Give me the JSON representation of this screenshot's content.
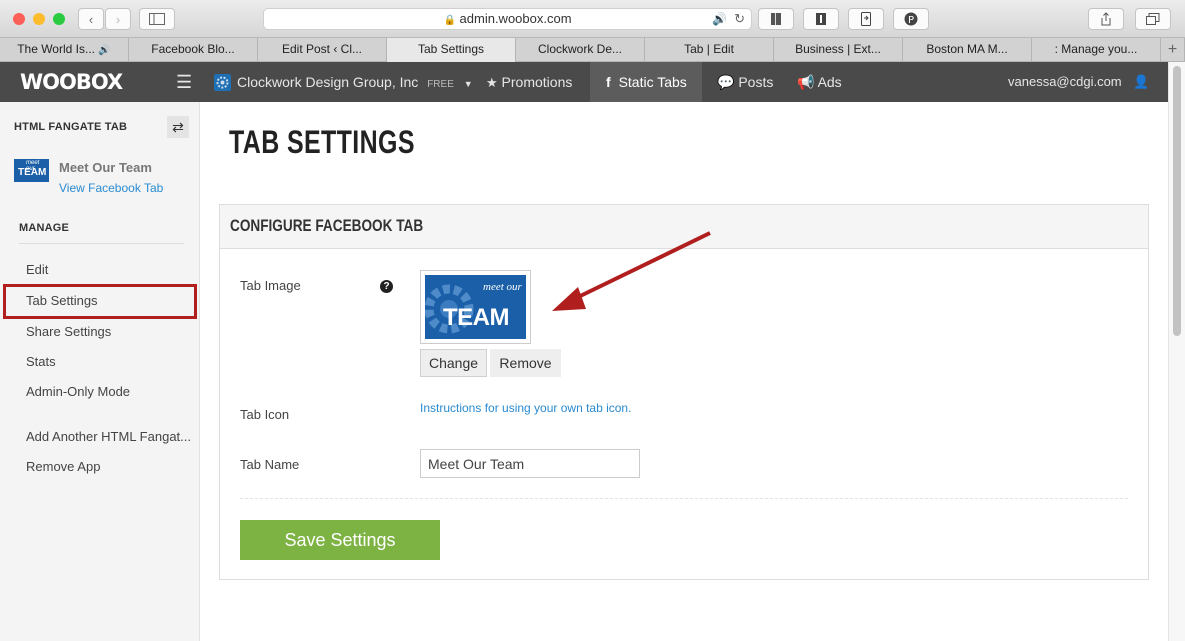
{
  "browser": {
    "url": "admin.woobox.com",
    "tabs": [
      {
        "label": "The World Is...",
        "audio": "🔊"
      },
      {
        "label": "Facebook Blo..."
      },
      {
        "label": "Edit Post ‹ Cl..."
      },
      {
        "label": "Tab Settings"
      },
      {
        "label": "Clockwork De..."
      },
      {
        "label": "Tab | Edit"
      },
      {
        "label": "Business | Ext..."
      },
      {
        "label": "Boston MA M..."
      },
      {
        "label": ": Manage you..."
      }
    ],
    "new_tab": "+"
  },
  "nav": {
    "logo": "WOOBOX",
    "menu_icon": "☰",
    "page_name": "Clockwork Design Group, Inc",
    "plan": "FREE",
    "items": {
      "promotions": "Promotions",
      "static_tabs": "Static Tabs",
      "posts": "Posts",
      "ads": "Ads"
    },
    "user": "vanessa@cdgi.com"
  },
  "sidebar": {
    "app_type": "HTML FANGATE TAB",
    "tab_name": "Meet Our Team",
    "view_link": "View Facebook Tab",
    "manage_heading": "MANAGE",
    "items": [
      "Edit",
      "Tab Settings",
      "Share Settings",
      "Stats",
      "Admin-Only Mode"
    ],
    "add_another": "Add Another HTML Fangat...",
    "remove_app": "Remove App",
    "thumb_small_text": "meet our",
    "thumb_big_text": "TEAM"
  },
  "main": {
    "title": "TAB SETTINGS",
    "panel_title": "CONFIGURE FACEBOOK TAB",
    "tab_image_label": "Tab Image",
    "help": "?",
    "image_small_text": "meet our",
    "image_big_text": "TEAM",
    "change_button": "Change",
    "remove_button": "Remove",
    "tab_icon_label": "Tab Icon",
    "tab_icon_link": "Instructions for using your own tab icon.",
    "tab_name_label": "Tab Name",
    "tab_name_value": "Meet Our Team",
    "save_button": "Save Settings"
  },
  "colors": {
    "nav_bg": "#4a4a4a",
    "link": "#2a8bd0",
    "save_green": "#7cb342",
    "highlight_red": "#b01e1e",
    "team_blue": "#1a5fa8"
  }
}
